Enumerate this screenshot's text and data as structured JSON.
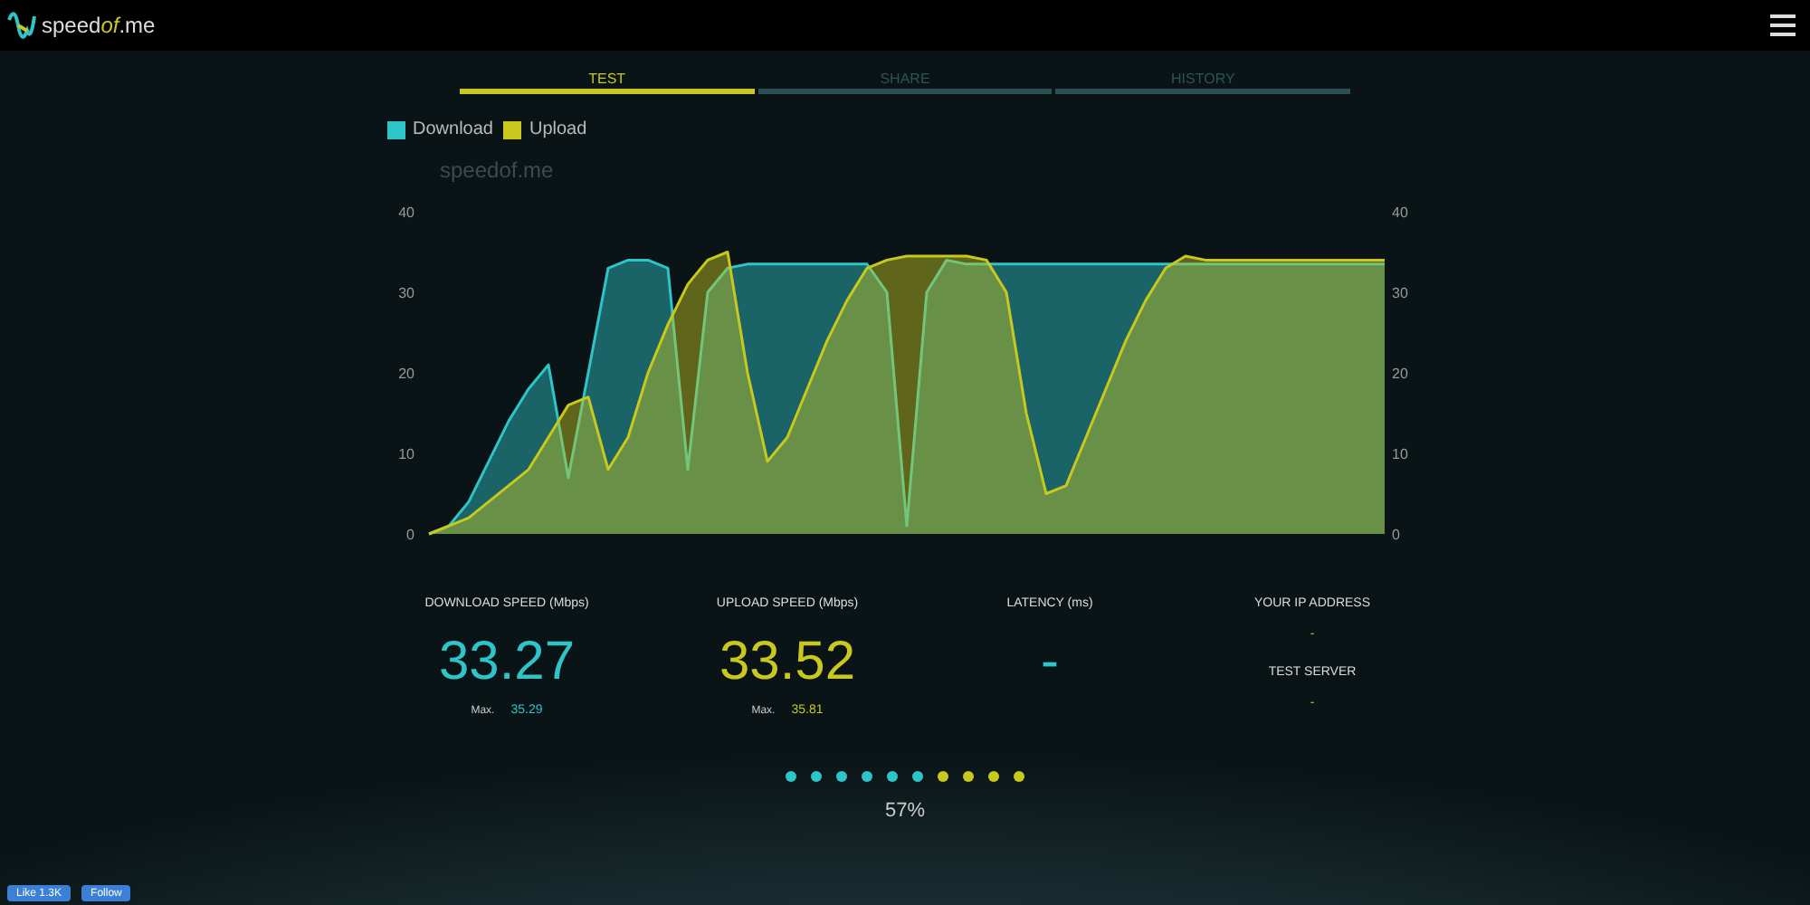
{
  "header": {
    "logo": {
      "prefix": "speed",
      "accent": "of",
      "suffix": ".me"
    }
  },
  "tabs": [
    {
      "label": "TEST",
      "selected": true
    },
    {
      "label": "SHARE",
      "selected": false
    },
    {
      "label": "HISTORY",
      "selected": false
    }
  ],
  "chart": {
    "brand": "speedof.me",
    "right_axis_ticks": [
      "40",
      "30",
      "20",
      "10",
      "0"
    ],
    "chart_data": {
      "type": "area",
      "yticks": [
        0,
        10,
        20,
        30,
        40
      ],
      "ylim": [
        0,
        40
      ],
      "series": [
        {
          "name": "Download",
          "color": "#2ec4c8",
          "values": [
            0,
            1,
            4,
            9,
            14,
            18,
            21,
            7,
            20,
            33,
            34,
            34,
            33,
            8,
            30,
            33,
            33.5,
            33.5,
            33.5,
            33.5,
            33.5,
            33.5,
            33.5,
            30,
            1,
            30,
            34,
            33.5,
            33.5,
            33.5,
            33.5,
            33.5,
            33.5,
            33.5,
            33.5,
            33.5,
            33.5,
            33.5,
            33.5,
            33.5,
            33.5,
            33.5,
            33.5,
            33.5,
            33.5,
            33.5,
            33.5,
            33.5,
            33.5
          ]
        },
        {
          "name": "Upload",
          "color": "#c8c81e",
          "values": [
            0,
            1,
            2,
            4,
            6,
            8,
            12,
            16,
            17,
            8,
            12,
            20,
            26,
            31,
            34,
            35,
            20,
            9,
            12,
            18,
            24,
            29,
            33,
            34,
            34.5,
            34.5,
            34.5,
            34.5,
            34,
            30,
            15,
            5,
            6,
            12,
            18,
            24,
            29,
            33,
            34.5,
            34,
            34,
            34,
            34,
            34,
            34,
            34,
            34,
            34,
            34
          ]
        }
      ]
    }
  },
  "stats": [
    {
      "kind": "speed",
      "label": "DOWNLOAD SPEED (Mbps)",
      "value": "33.27",
      "max_label": "Max.",
      "max_value": "35.29",
      "color": "#2ec4c8"
    },
    {
      "kind": "speed",
      "label": "UPLOAD SPEED (Mbps)",
      "value": "33.52",
      "max_label": "Max.",
      "max_value": "35.81",
      "color": "#c8c81e"
    },
    {
      "kind": "speed",
      "label": "LATENCY (ms)",
      "value": "-",
      "color": "#2ec4c8"
    },
    {
      "kind": "info",
      "label": "YOUR IP ADDRESS",
      "value": "-",
      "label_2": "TEST SERVER",
      "value_2": "-"
    }
  ],
  "progress": {
    "steps": [
      {
        "color": "#2ec4c8"
      },
      {
        "color": "#2ec4c8"
      },
      {
        "color": "#2ec4c8"
      },
      {
        "color": "#2ec4c8"
      },
      {
        "color": "#2ec4c8"
      },
      {
        "color": "#2ec4c8"
      },
      {
        "color": "#c8c81e"
      },
      {
        "color": "#c8c81e"
      },
      {
        "color": "#c8c81e"
      },
      {
        "color": "#c8c81e"
      }
    ],
    "percent": "57%"
  },
  "social": {
    "like": "Like 1.3K",
    "follow": "Follow"
  }
}
